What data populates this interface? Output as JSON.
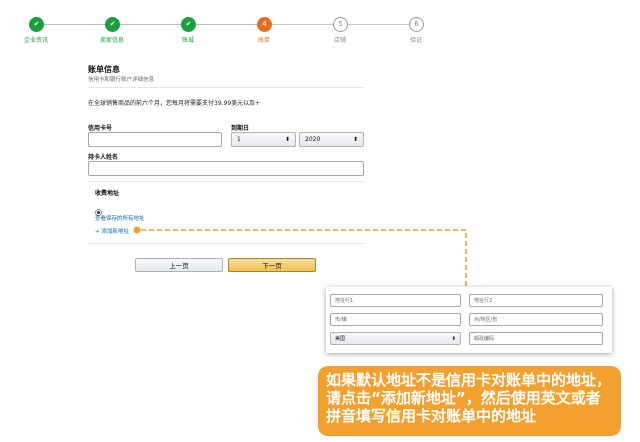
{
  "stepper": {
    "steps": [
      {
        "label": "企业资讯",
        "glyph": "✔",
        "state": "done"
      },
      {
        "label": "卖家信息",
        "glyph": "✔",
        "state": "done"
      },
      {
        "label": "账城",
        "glyph": "✔",
        "state": "done"
      },
      {
        "label": "账单",
        "glyph": "4",
        "state": "current"
      },
      {
        "label": "店铺",
        "glyph": "5",
        "state": "todo"
      },
      {
        "label": "验证",
        "glyph": "6",
        "state": "todo"
      }
    ],
    "colors": {
      "done": "#1b9e3e",
      "current": "#e4701e",
      "todo": "#9a9a9a"
    }
  },
  "billing": {
    "title": "账单信息",
    "subtitle": "信用卡和银行账户详细信息",
    "notice": "在全球销售商品的前六个月，您每月将需要支付39.99美元以及+",
    "card_number_label": "信用卡号",
    "card_number_value": "",
    "expiry_label": "到期日",
    "expiry_month": "1",
    "expiry_year": "2020",
    "holder_label": "持卡人姓名",
    "holder_value": ""
  },
  "address": {
    "title": "收费地址",
    "view_saved_link": "查看保存的所有地址",
    "add_new_link": "+ 添加新地址"
  },
  "buttons": {
    "prev": "上一页",
    "next": "下一页"
  },
  "address_form": {
    "line1": "地址行1",
    "line2": "地址行2",
    "city": "市/镇",
    "state": "州/地区/省",
    "country": "美国",
    "zip": "邮政编码"
  },
  "callout": {
    "text": "如果默认地址不是信用卡对账单中的地址，请点击“添加新地址”，然后使用英文或者拼音填写信用卡对账单中的地址",
    "color": "#f4a02e"
  },
  "icons": {
    "radio": "radio-dot-icon",
    "chevron": "select-chevron-icon",
    "arrow": "dashed-arrow-icon"
  }
}
